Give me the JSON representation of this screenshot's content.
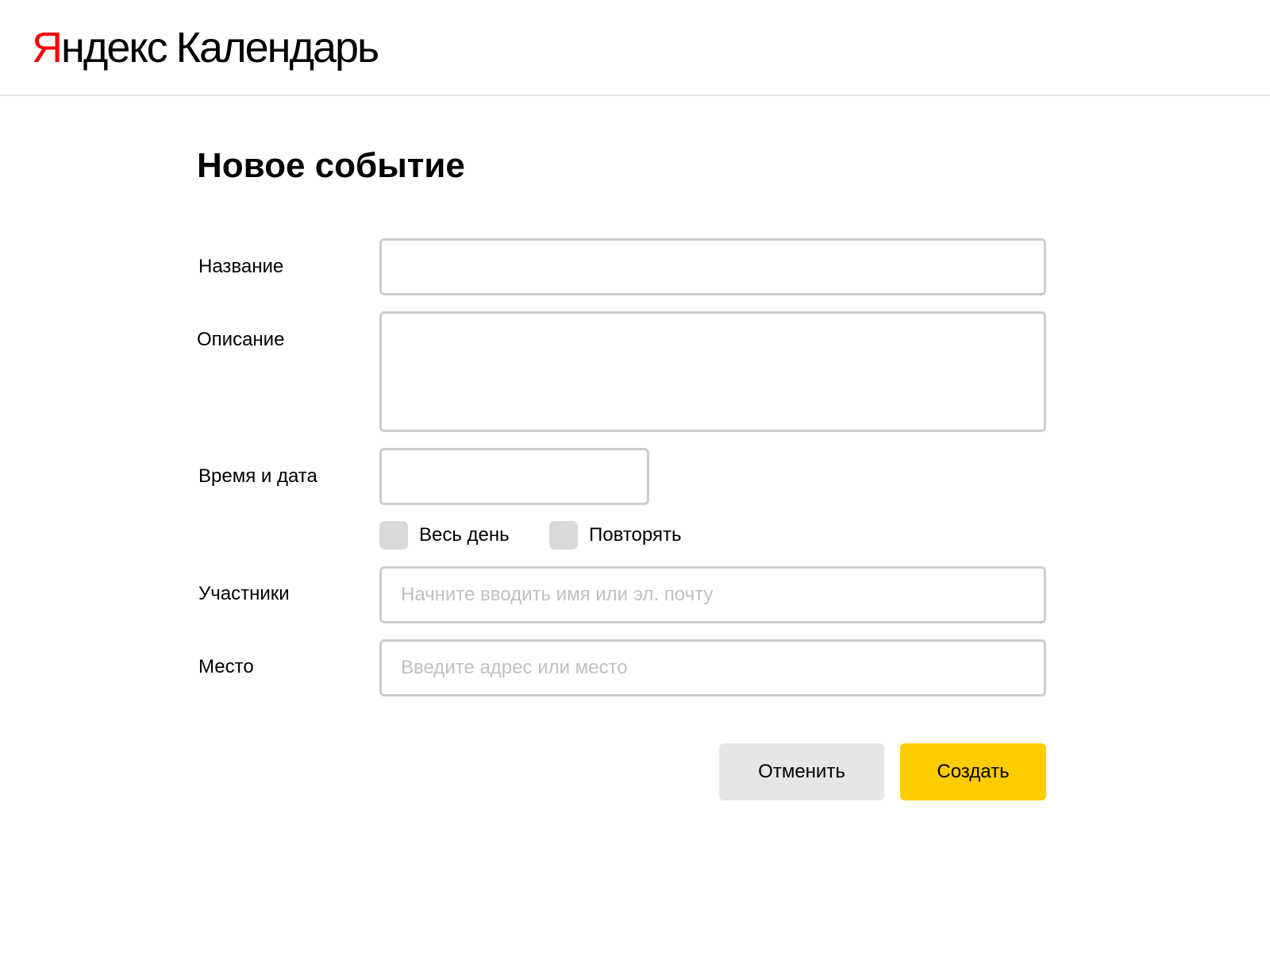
{
  "header": {
    "logo_brand_first": "Я",
    "logo_brand_rest": "ндекс",
    "logo_product": "Календарь",
    "brand_color": "#fc0000"
  },
  "page": {
    "title": "Новое событие"
  },
  "form": {
    "title_label": "Название",
    "title_value": "",
    "description_label": "Описание",
    "description_value": "",
    "datetime_label": "Время и дата",
    "datetime_value": "",
    "all_day_label": "Весь день",
    "all_day_checked": false,
    "repeat_label": "Повторять",
    "repeat_checked": false,
    "participants_label": "Участники",
    "participants_placeholder": "Начните вводить имя или эл. почту",
    "place_label": "Место",
    "place_placeholder": "Введите адрес или место"
  },
  "actions": {
    "cancel_label": "Отменить",
    "create_label": "Создать",
    "create_color": "#ffcc00",
    "cancel_color": "#e6e6e6"
  }
}
